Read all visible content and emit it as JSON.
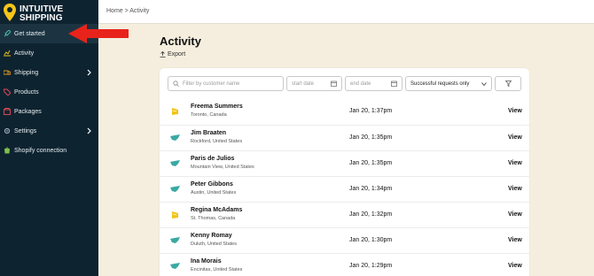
{
  "brand": {
    "line1": "INTUITIVE",
    "line2": "SHIPPING",
    "accent": "#f5c518"
  },
  "sidebar": {
    "items": [
      {
        "label": "Get started",
        "icon": "rocket-icon",
        "active": true
      },
      {
        "label": "Activity",
        "icon": "activity-chart-icon"
      },
      {
        "label": "Shipping",
        "icon": "truck-icon",
        "has_submenu": true
      },
      {
        "label": "Products",
        "icon": "tag-icon"
      },
      {
        "label": "Packages",
        "icon": "box-icon"
      },
      {
        "label": "Settings",
        "icon": "gear-icon",
        "has_submenu": true
      },
      {
        "label": "Shopify connection",
        "icon": "shopify-icon"
      }
    ]
  },
  "breadcrumb": "Home > Activity",
  "page": {
    "title": "Activity",
    "export_label": "Export"
  },
  "filters": {
    "search_placeholder": "Filter by customer name",
    "start_date_placeholder": "start date",
    "end_date_placeholder": "end date",
    "status_selected": "Successful requests only"
  },
  "rows": [
    {
      "name": "Freema Summers",
      "location": "Toronto, Canada",
      "date": "Jan 20, 1:37pm",
      "action": "View",
      "carrier_icon": "canada-post-icon"
    },
    {
      "name": "Jim Braaten",
      "location": "Rockford, United States",
      "date": "Jan 20, 1:35pm",
      "action": "View",
      "carrier_icon": "usps-eagle-icon"
    },
    {
      "name": "Paris de Julios",
      "location": "Mountain View, United States",
      "date": "Jan 20, 1:35pm",
      "action": "View",
      "carrier_icon": "usps-eagle-icon"
    },
    {
      "name": "Peter Gibbons",
      "location": "Austin, United States",
      "date": "Jan 20, 1:34pm",
      "action": "View",
      "carrier_icon": "usps-eagle-icon"
    },
    {
      "name": "Regina McAdams",
      "location": "St. Thomas, Canada",
      "date": "Jan 20, 1:32pm",
      "action": "View",
      "carrier_icon": "canada-post-icon"
    },
    {
      "name": "Kenny Romay",
      "location": "Duluth, United States",
      "date": "Jan 20, 1:30pm",
      "action": "View",
      "carrier_icon": "usps-eagle-icon"
    },
    {
      "name": "Ina Morais",
      "location": "Encinitas, United States",
      "date": "Jan 20, 1:29pm",
      "action": "View",
      "carrier_icon": "usps-eagle-icon"
    }
  ],
  "colors": {
    "sidebar_bg": "#0e2330",
    "page_bg": "#f5eede",
    "arrow": "#e8231b",
    "usps": "#3aa9a3",
    "canada_post": "#f0c419"
  }
}
